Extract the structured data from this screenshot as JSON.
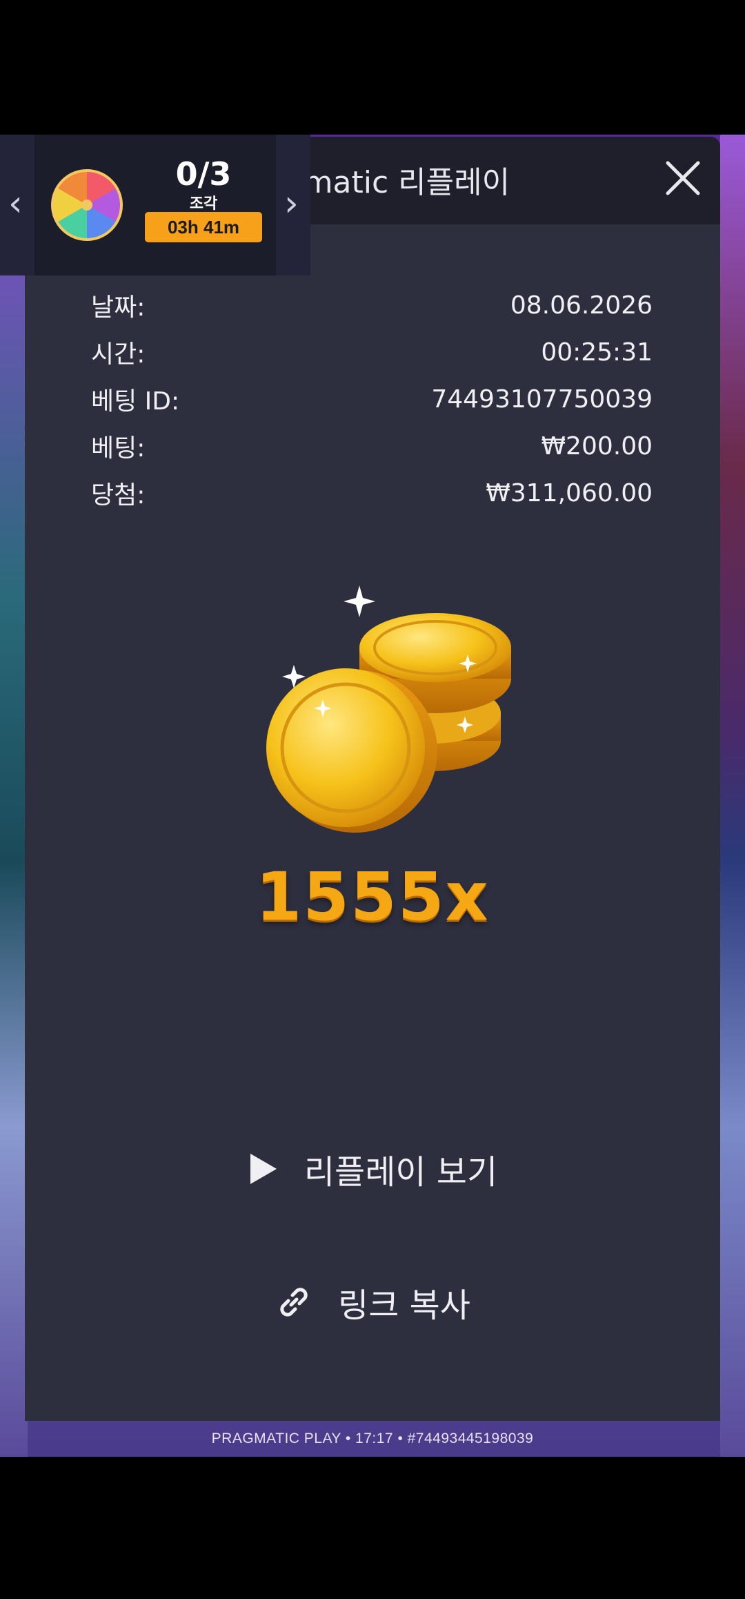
{
  "modal": {
    "title": "Pragmatic 리플레이",
    "close_label": "×"
  },
  "details": [
    {
      "label": "날짜:",
      "value": "08.06.2026"
    },
    {
      "label": "시간:",
      "value": "00:25:31"
    },
    {
      "label": "베팅 ID:",
      "value": "74493107750039"
    },
    {
      "label": "베팅:",
      "value": "₩200.00"
    },
    {
      "label": "당첨:",
      "value": "₩311,060.00"
    }
  ],
  "multiplier": "1555x",
  "actions": {
    "replay_label": "리플레이 보기",
    "copy_label": "링크 복사"
  },
  "widget": {
    "progress": "0/3",
    "pieces_label": "조각",
    "timer": "03h 41m",
    "icon": "prize-wheel-icon"
  },
  "footer": {
    "text": "PRAGMATIC PLAY • 17:17 • #74493445198039"
  },
  "colors": {
    "modal_bg": "#2e2f3e",
    "header_bg": "#1e1f2b",
    "accent_timer": "#f7a11a",
    "multiplier": "#f6a814"
  }
}
